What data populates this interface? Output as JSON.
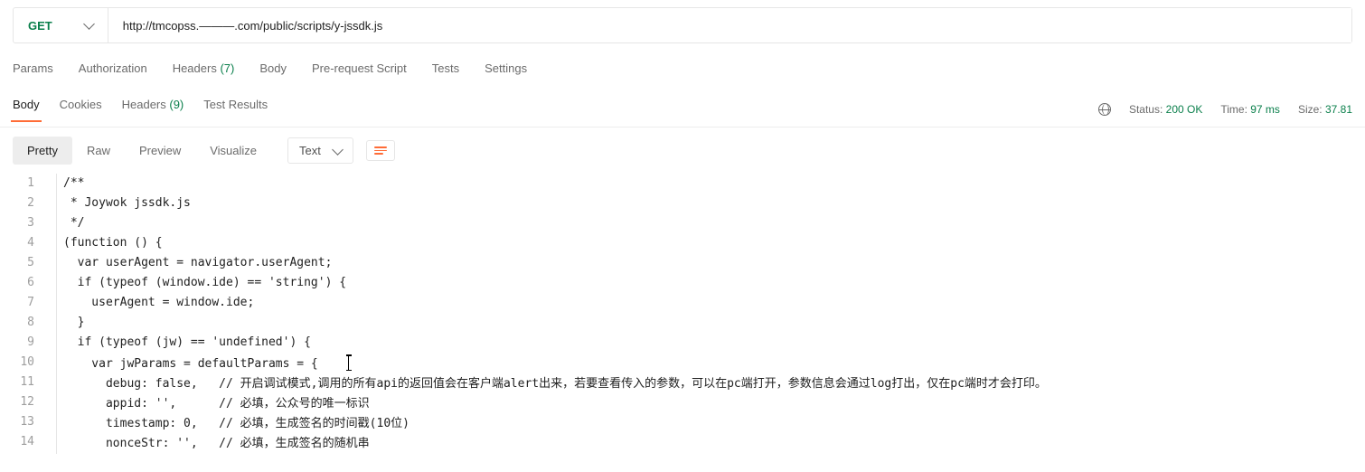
{
  "request": {
    "method": "GET",
    "url": "http://tmcopss.———.com/public/scripts/y-jssdk.js"
  },
  "req_tabs": {
    "params": "Params",
    "auth": "Authorization",
    "headers_label": "Headers",
    "headers_count": "(7)",
    "body": "Body",
    "prereq": "Pre-request Script",
    "tests": "Tests",
    "settings": "Settings"
  },
  "resp_tabs": {
    "body": "Body",
    "cookies": "Cookies",
    "headers_label": "Headers",
    "headers_count": "(9)",
    "test_results": "Test Results"
  },
  "status": {
    "status_label": "Status:",
    "status_value": "200 OK",
    "time_label": "Time:",
    "time_value": "97 ms",
    "size_label": "Size:",
    "size_value": "37.81"
  },
  "toolbar": {
    "pretty": "Pretty",
    "raw": "Raw",
    "preview": "Preview",
    "visualize": "Visualize",
    "format": "Text"
  },
  "code": {
    "lines": [
      "/**",
      " * Joywok jssdk.js",
      " */",
      "(function () {",
      "  var userAgent = navigator.userAgent;",
      "  if (typeof (window.ide) == 'string') {",
      "    userAgent = window.ide;",
      "  }",
      "  if (typeof (jw) == 'undefined') {",
      "    var jwParams = defaultParams = {",
      "      debug: false,   // 开启调试模式,调用的所有api的返回值会在客户端alert出来，若要查看传入的参数，可以在pc端打开，参数信息会通过log打出，仅在pc端时才会打印。",
      "      appid: '',      // 必填，公众号的唯一标识",
      "      timestamp: 0,   // 必填，生成签名的时间戳(10位)",
      "      nonceStr: '',   // 必填，生成签名的随机串"
    ]
  }
}
